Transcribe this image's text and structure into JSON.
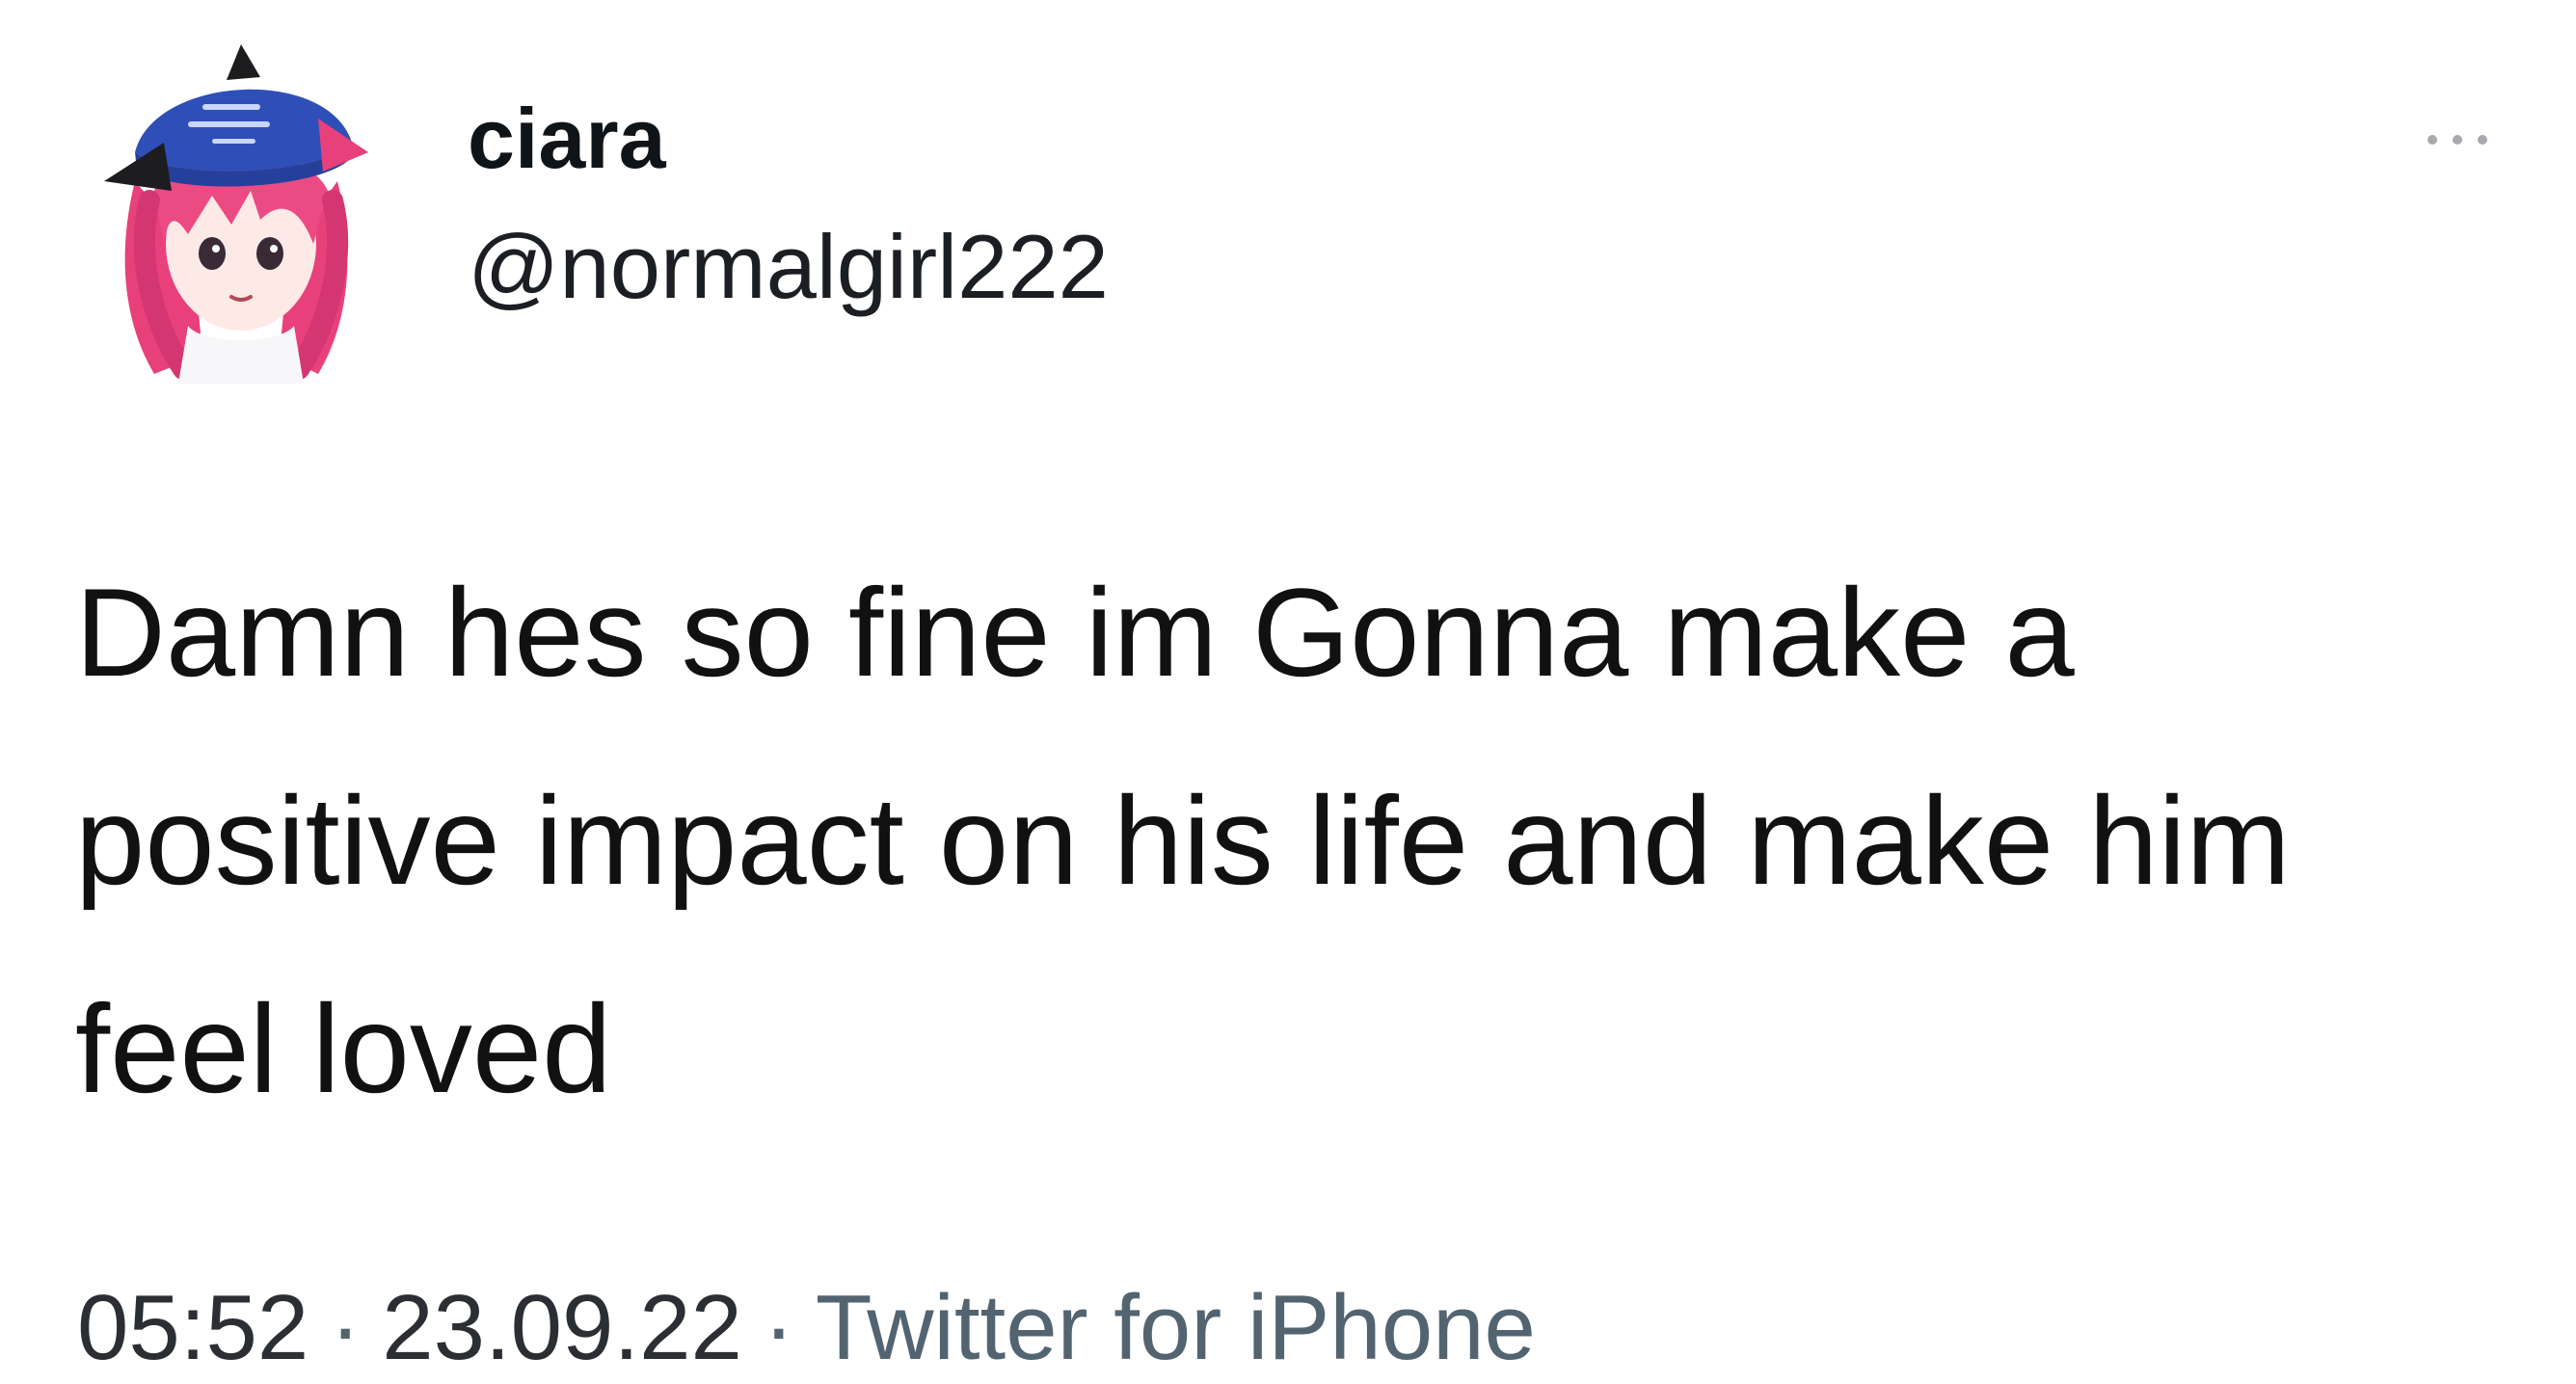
{
  "author": {
    "display_name": "ciara",
    "handle": "@normalgirl222",
    "avatar_icon": "anime-girl-avatar-icon"
  },
  "tweet": {
    "text": "Damn hes so fine  im Gonna make a\npositive impact on his life and make him\nfeel loved"
  },
  "meta": {
    "time": "05:52",
    "separator": "·",
    "date": "23.09.22",
    "source": "Twitter for iPhone"
  },
  "colors": {
    "avatar_hair": "#e8407a",
    "avatar_hat": "#2f4fb8",
    "meta_gray": "#536471"
  }
}
